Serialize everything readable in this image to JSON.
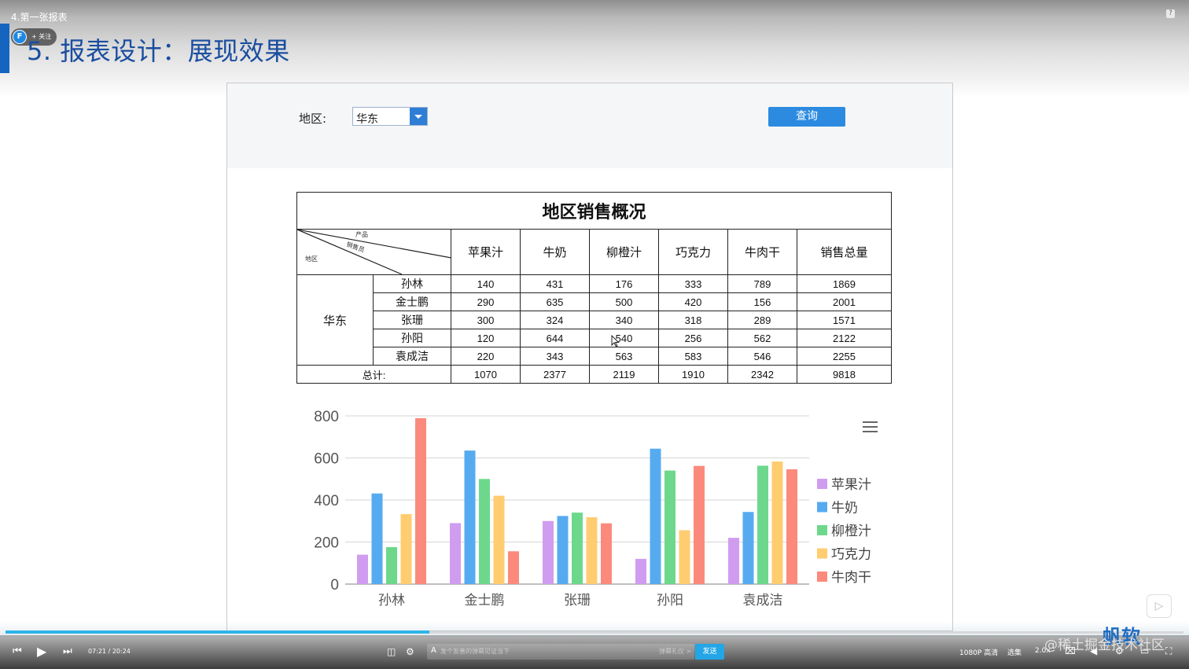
{
  "video": {
    "title": "4.第一张报表",
    "help_label": "?",
    "follow_label": "+ 关注",
    "channel_logo_letter": "F"
  },
  "slide": {
    "title": "5. 报表设计：展现效果"
  },
  "params": {
    "region_label": "地区:",
    "region_value": "华东",
    "query_label": "查询"
  },
  "table": {
    "title": "地区销售概况",
    "corner": {
      "product": "产品",
      "salesperson": "销售员",
      "region": "地区"
    },
    "columns": [
      "苹果汁",
      "牛奶",
      "柳橙汁",
      "巧克力",
      "牛肉干",
      "销售总量"
    ],
    "region": "华东",
    "rows": [
      {
        "name": "孙林",
        "values": [
          "140",
          "431",
          "176",
          "333",
          "789",
          "1869"
        ]
      },
      {
        "name": "金士鹏",
        "values": [
          "290",
          "635",
          "500",
          "420",
          "156",
          "2001"
        ]
      },
      {
        "name": "张珊",
        "values": [
          "300",
          "324",
          "340",
          "318",
          "289",
          "1571"
        ]
      },
      {
        "name": "孙阳",
        "values": [
          "120",
          "644",
          "540",
          "256",
          "562",
          "2122"
        ]
      },
      {
        "name": "袁成洁",
        "values": [
          "220",
          "343",
          "563",
          "583",
          "546",
          "2255"
        ]
      }
    ],
    "total_label": "总计:",
    "totals": [
      "1070",
      "2377",
      "2119",
      "1910",
      "2342",
      "9818"
    ]
  },
  "chart_data": {
    "type": "bar",
    "categories": [
      "孙林",
      "金士鹏",
      "张珊",
      "孙阳",
      "袁成洁"
    ],
    "series": [
      {
        "name": "苹果汁",
        "color": "#d09cf0",
        "values": [
          140,
          290,
          300,
          120,
          220
        ]
      },
      {
        "name": "牛奶",
        "color": "#56abf0",
        "values": [
          431,
          635,
          324,
          644,
          343
        ]
      },
      {
        "name": "柳橙汁",
        "color": "#6dd88c",
        "values": [
          176,
          500,
          340,
          540,
          563
        ]
      },
      {
        "name": "巧克力",
        "color": "#ffcc70",
        "values": [
          333,
          420,
          318,
          256,
          583
        ]
      },
      {
        "name": "牛肉干",
        "color": "#fb8a7c",
        "values": [
          789,
          156,
          289,
          562,
          546
        ]
      }
    ],
    "yticks": [
      "0",
      "200",
      "400",
      "600",
      "800"
    ],
    "ylim": [
      0,
      800
    ],
    "grid": true,
    "legend_position": "right"
  },
  "player": {
    "time": "07:21 / 20:24",
    "danmaku_placeholder": "发个友善的弹幕见证当下",
    "danmaku_etiquette": "弹幕礼仪 >",
    "send_label": "发送",
    "quality": "1080P 高清",
    "episodes": "选集",
    "speed": "2.0x",
    "progress_fraction": 0.36
  },
  "watermark": "@稀土掘金技术社区",
  "brand": "帆软"
}
